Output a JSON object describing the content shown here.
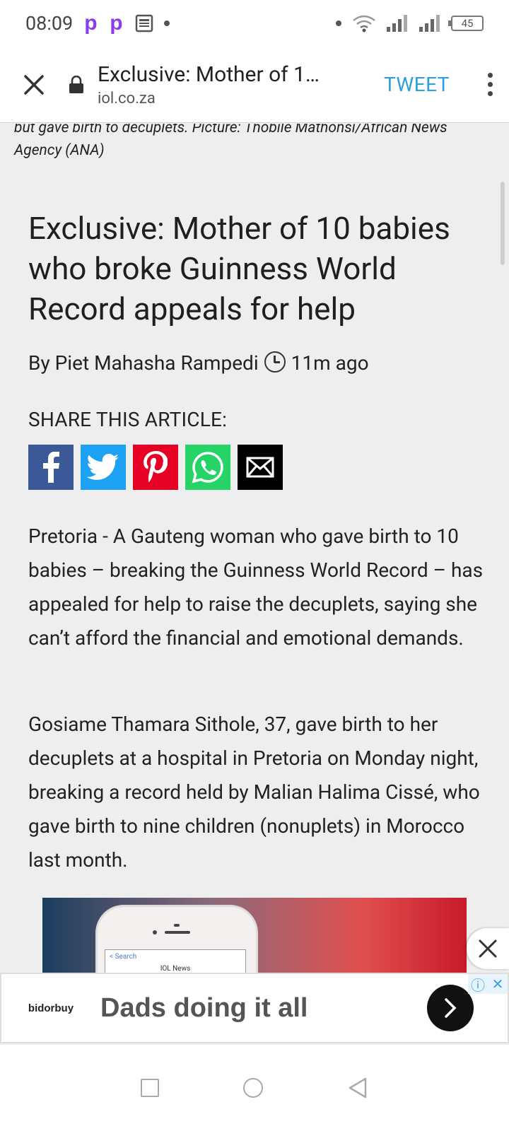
{
  "status_bar": {
    "time": "08:09",
    "battery": "45"
  },
  "toolbar": {
    "title": "Exclusive: Mother of 1…",
    "url": "iol.co.za",
    "tweet_label": "TWEET"
  },
  "article": {
    "caption": "but gave birth to decuplets. Picture: Thobile Mathonsi/African News Agency (ANA)",
    "headline": "Exclusive: Mother of 10 babies who broke Guinness World Record appeals for help",
    "author": "By Piet Mahasha Rampedi",
    "time_ago": "11m ago",
    "share_label": "SHARE THIS ARTICLE:",
    "share_buttons": [
      {
        "name": "facebook",
        "glyph": "f",
        "color": "#3b5998"
      },
      {
        "name": "twitter",
        "glyph": "",
        "color": "#1da1f2"
      },
      {
        "name": "pinterest",
        "glyph": "",
        "color": "#e60023"
      },
      {
        "name": "whatsapp",
        "glyph": "",
        "color": "#25d366"
      },
      {
        "name": "email",
        "glyph": "",
        "color": "#000000"
      }
    ],
    "paragraphs": [
      "Pretoria - A Gauteng woman who gave birth to 10 babies – breaking the Guinness World Record – has appealed for help to raise the decuplets, saying she can’t afford the financial and emotional demands.",
      "Gosiame Thamara Sithole, 37, gave birth to her decuplets at a hospital in Pretoria on Monday night, breaking a record held by Malian Halima Cissé, who gave birth to nine children (nonuplets) in Morocco last month."
    ],
    "image_screen_text": {
      "back": "Search",
      "title": "IOL News"
    }
  },
  "ad": {
    "brand": "bidorbuy",
    "text": "Dads doing it all"
  }
}
